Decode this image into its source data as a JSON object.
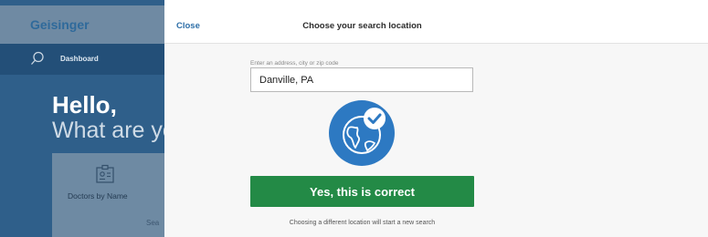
{
  "background": {
    "logo": "Geisinger",
    "nav_label": "Dashboard",
    "hello": "Hello,",
    "question": "What are yo",
    "card_label": "Doctors by Name",
    "card_sub": "Sea"
  },
  "sheet": {
    "close_label": "Close",
    "title": "Choose your search location",
    "field_label": "Enter an address, city or zip code",
    "address_value": "Danville, PA",
    "confirm_label": "Yes, this is correct",
    "note": "Choosing a different location will start a new search"
  },
  "colors": {
    "primary_blue": "#2e6fa8",
    "confirm_green": "#238a46",
    "globe_blue": "#2d79c2"
  },
  "icons": [
    "search-icon",
    "id-card-icon",
    "globe-check-icon"
  ]
}
